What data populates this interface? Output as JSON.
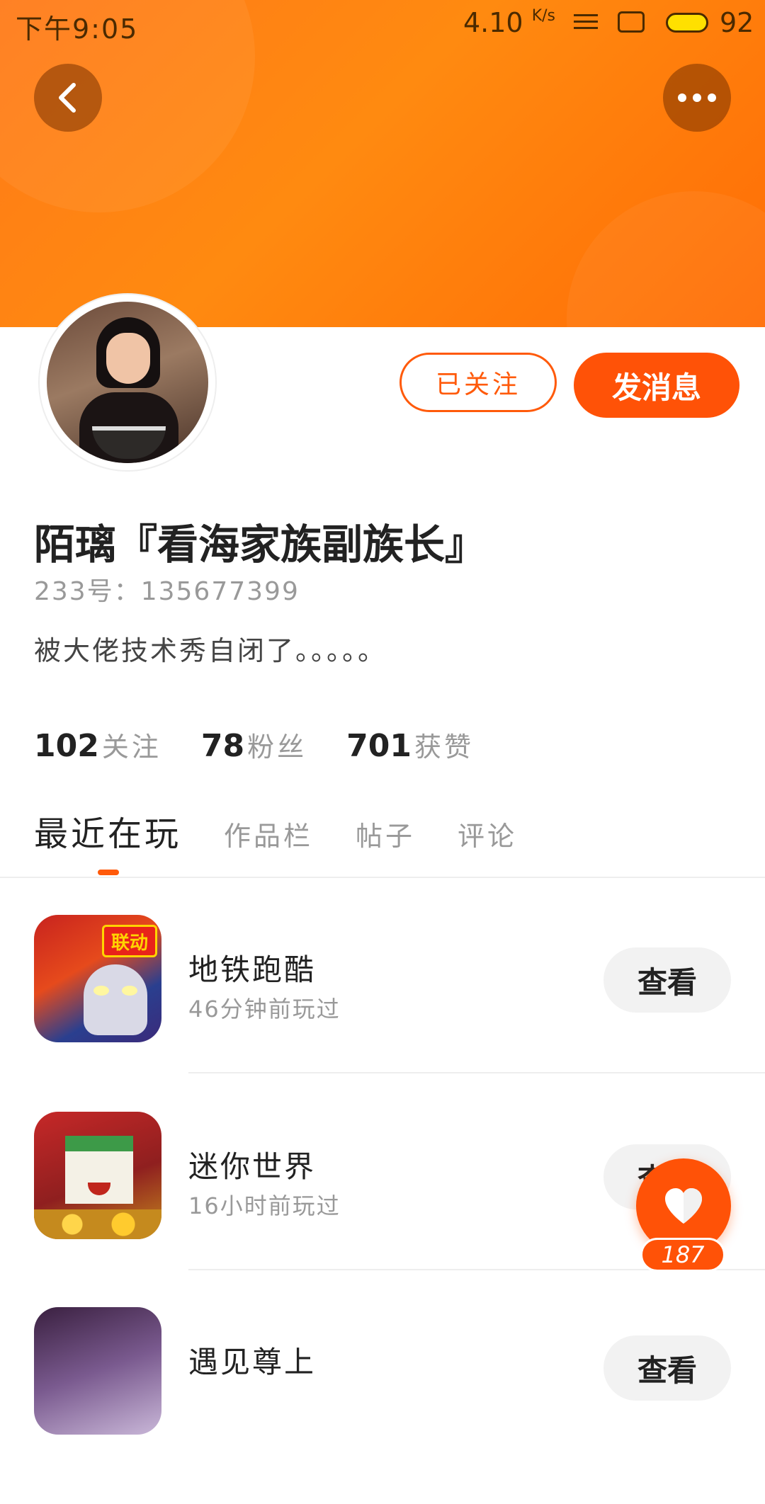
{
  "status_bar": {
    "time": "下午9:05",
    "speed": "4.10",
    "speed_unit": "K/s",
    "battery": "92"
  },
  "header": {
    "back_icon": "chevron-left-icon",
    "more_icon": "more-dots-icon",
    "gradient_colors": [
      "#ff7a18",
      "#ff6d06"
    ]
  },
  "profile": {
    "follow_button": "已关注",
    "message_button": "发消息",
    "username": "陌璃『看海家族副族长』",
    "uid": "233号：135677399",
    "bio": "被大佬技术秀自闭了。。。。。",
    "stats": [
      {
        "num": "102",
        "label": "关注"
      },
      {
        "num": "78",
        "label": "粉丝"
      },
      {
        "num": "701",
        "label": "获赞"
      }
    ]
  },
  "tabs": [
    {
      "label": "最近在玩",
      "active": true
    },
    {
      "label": "作品栏",
      "active": false
    },
    {
      "label": "帖子",
      "active": false
    },
    {
      "label": "评论",
      "active": false
    }
  ],
  "games": [
    {
      "name": "地铁跑酷",
      "played": "46分钟前玩过",
      "action": "查看",
      "badge": "联动"
    },
    {
      "name": "迷你世界",
      "played": "16小时前玩过",
      "action": "查看"
    },
    {
      "name": "遇见尊上",
      "played": "",
      "action": "查看"
    }
  ],
  "floating_like": {
    "icon": "heart-icon",
    "count": "187"
  },
  "colors": {
    "accent": "#ff5207",
    "text_primary": "#222222",
    "text_secondary": "#999999"
  }
}
